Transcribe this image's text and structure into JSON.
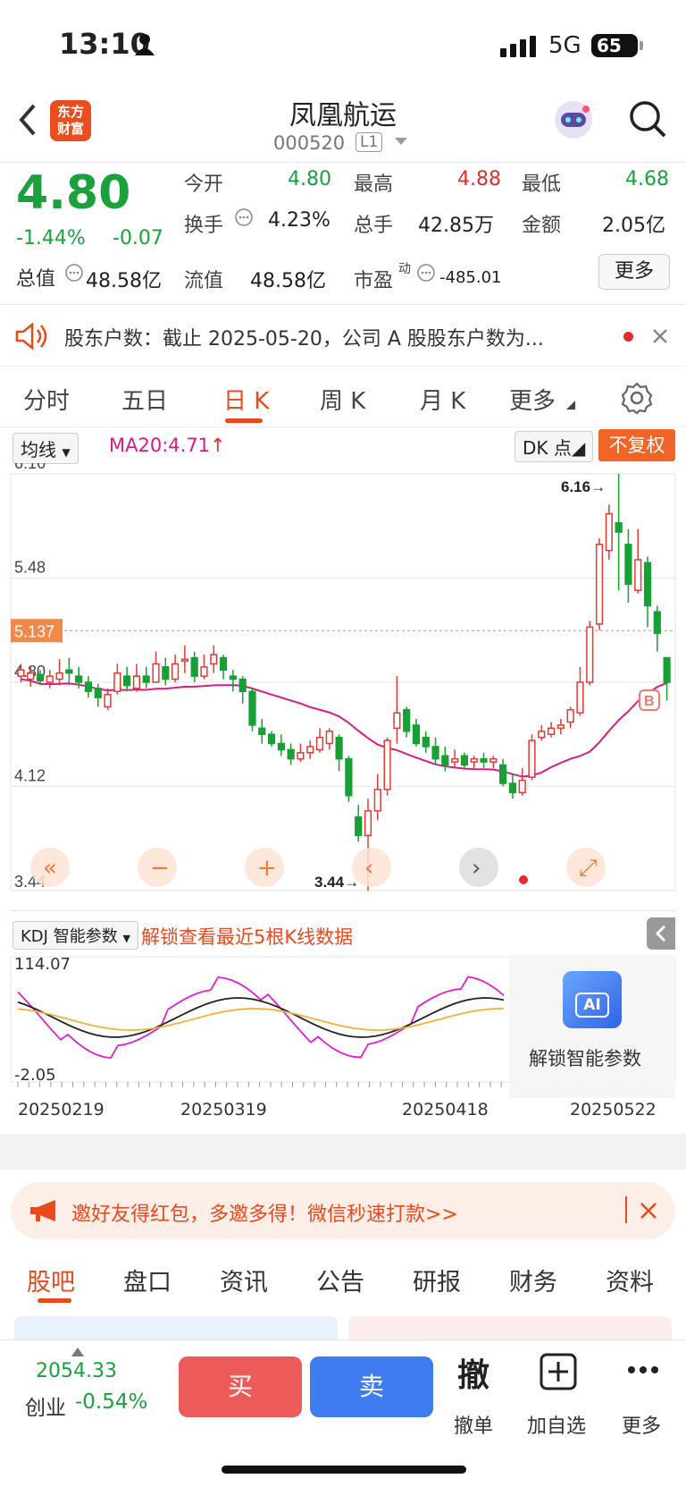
{
  "status": {
    "time": "13:10",
    "network": "5G",
    "battery": "65"
  },
  "header": {
    "title": "凤凰航运",
    "code": "000520",
    "level": "L1",
    "logo_line1": "东方",
    "logo_line2": "财富"
  },
  "quote": {
    "price": "4.80",
    "pct": "-1.44%",
    "chg": "-0.07",
    "open_label": "今开",
    "open": "4.80",
    "high_label": "最高",
    "high": "4.88",
    "low_label": "最低",
    "low": "4.68",
    "turnover_label": "换手",
    "turnover": "4.23%",
    "volume_label": "总手",
    "volume": "42.85万",
    "amount_label": "金额",
    "amount": "2.05亿",
    "mktcap_label": "总值",
    "mktcap": "48.58亿",
    "float_label": "流值",
    "float": "48.58亿",
    "pe_label": "市盈",
    "pe_sup": "动",
    "pe": "-485.01",
    "more": "更多"
  },
  "notice": {
    "text": "股东户数：截止 2025-05-20，公司 A 股股东户数为..."
  },
  "tabs": [
    "分时",
    "五日",
    "日 K",
    "周 K",
    "月 K",
    "更多"
  ],
  "active_tab": 2,
  "kline": {
    "ma_select": "均线",
    "ma_text": "MA20:4.71",
    "dk": "DK 点",
    "fq": "不复权",
    "y_labels": [
      "6.16",
      "5.48",
      "4.80",
      "4.12",
      "3.44"
    ],
    "ref_price": "5.137",
    "max_label": "6.16",
    "min_label": "3.44",
    "b_badge": "B"
  },
  "kdj": {
    "select": "KDJ 智能参数",
    "unlock_text": "解锁查看最近5根K线数据",
    "ymax": "114.07",
    "ymin": "-2.05",
    "ai_badge": "AI",
    "ai_text": "解锁智能参数",
    "dates": [
      "20250219",
      "20250319",
      "20250418",
      "20250522"
    ]
  },
  "banner": {
    "text": "邀好友得红包，多邀多得！微信秒速打款>>"
  },
  "bottom_tabs": [
    "股吧",
    "盘口",
    "资讯",
    "公告",
    "研报",
    "财务",
    "资料"
  ],
  "bottom": {
    "index_value": "2054.33",
    "index_name": "创业",
    "index_pct": "-0.54%",
    "buy": "买",
    "sell": "卖",
    "cancel_icon": "撤",
    "cancel": "撤单",
    "add": "加自选",
    "more": "更多"
  },
  "chart_data": {
    "type": "candlestick",
    "ylim": [
      3.44,
      6.16
    ],
    "candles": [
      [
        4.84,
        4.88,
        4.8,
        4.92
      ],
      [
        4.82,
        4.86,
        4.77,
        4.9
      ],
      [
        4.85,
        4.81,
        4.78,
        4.88
      ],
      [
        4.8,
        4.84,
        4.76,
        4.88
      ],
      [
        4.82,
        4.86,
        4.78,
        4.95
      ],
      [
        4.88,
        4.86,
        4.78,
        4.96
      ],
      [
        4.84,
        4.8,
        4.76,
        4.9
      ],
      [
        4.8,
        4.74,
        4.7,
        4.84
      ],
      [
        4.76,
        4.7,
        4.64,
        4.79
      ],
      [
        4.64,
        4.72,
        4.62,
        4.76
      ],
      [
        4.74,
        4.86,
        4.72,
        4.92
      ],
      [
        4.84,
        4.78,
        4.74,
        4.9
      ],
      [
        4.76,
        4.84,
        4.74,
        4.92
      ],
      [
        4.84,
        4.8,
        4.76,
        4.9
      ],
      [
        4.8,
        4.92,
        4.8,
        5.0
      ],
      [
        4.9,
        4.82,
        4.78,
        4.96
      ],
      [
        4.82,
        4.92,
        4.8,
        4.98
      ],
      [
        4.94,
        4.95,
        4.86,
        5.04
      ],
      [
        4.96,
        4.84,
        4.8,
        5.0
      ],
      [
        4.84,
        4.9,
        4.82,
        4.98
      ],
      [
        4.92,
        4.98,
        4.86,
        5.04
      ],
      [
        4.96,
        4.88,
        4.82,
        4.98
      ],
      [
        4.84,
        4.82,
        4.74,
        4.88
      ],
      [
        4.82,
        4.74,
        4.66,
        4.84
      ],
      [
        4.74,
        4.52,
        4.48,
        4.76
      ],
      [
        4.5,
        4.46,
        4.4,
        4.56
      ],
      [
        4.46,
        4.4,
        4.38,
        4.48
      ],
      [
        4.4,
        4.36,
        4.32,
        4.46
      ],
      [
        4.36,
        4.3,
        4.26,
        4.4
      ],
      [
        4.3,
        4.34,
        4.28,
        4.4
      ],
      [
        4.34,
        4.38,
        4.3,
        4.42
      ],
      [
        4.36,
        4.44,
        4.34,
        4.5
      ],
      [
        4.4,
        4.48,
        4.36,
        4.5
      ],
      [
        4.44,
        4.3,
        4.22,
        4.46
      ],
      [
        4.3,
        4.06,
        4.02,
        4.32
      ],
      [
        3.92,
        3.8,
        3.76,
        4.0
      ],
      [
        3.8,
        3.96,
        3.44,
        4.04
      ],
      [
        3.96,
        4.1,
        3.9,
        4.2
      ],
      [
        4.1,
        4.42,
        4.06,
        4.44
      ],
      [
        4.5,
        4.6,
        4.4,
        4.84
      ],
      [
        4.62,
        4.48,
        4.44,
        4.64
      ],
      [
        4.52,
        4.4,
        4.38,
        4.56
      ],
      [
        4.44,
        4.38,
        4.34,
        4.48
      ],
      [
        4.38,
        4.3,
        4.26,
        4.44
      ],
      [
        4.32,
        4.26,
        4.22,
        4.38
      ],
      [
        4.28,
        4.3,
        4.24,
        4.36
      ],
      [
        4.32,
        4.26,
        4.24,
        4.34
      ],
      [
        4.28,
        4.3,
        4.24,
        4.32
      ],
      [
        4.3,
        4.28,
        4.24,
        4.34
      ],
      [
        4.28,
        4.3,
        4.24,
        4.32
      ],
      [
        4.26,
        4.14,
        4.12,
        4.3
      ],
      [
        4.14,
        4.08,
        4.04,
        4.2
      ],
      [
        4.08,
        4.16,
        4.06,
        4.24
      ],
      [
        4.18,
        4.42,
        4.16,
        4.46
      ],
      [
        4.44,
        4.48,
        4.42,
        4.52
      ],
      [
        4.46,
        4.5,
        4.44,
        4.54
      ],
      [
        4.5,
        4.52,
        4.46,
        4.56
      ],
      [
        4.54,
        4.62,
        4.5,
        4.64
      ],
      [
        4.6,
        4.8,
        4.58,
        4.9
      ],
      [
        4.8,
        5.16,
        4.78,
        5.2
      ],
      [
        5.18,
        5.7,
        5.14,
        5.74
      ],
      [
        5.66,
        5.9,
        5.6,
        5.96
      ],
      [
        5.84,
        5.78,
        5.4,
        6.16
      ],
      [
        5.7,
        5.44,
        5.32,
        5.8
      ],
      [
        5.4,
        5.6,
        5.38,
        5.8
      ],
      [
        5.58,
        5.3,
        5.16,
        5.62
      ],
      [
        5.26,
        5.12,
        5.0,
        5.3
      ],
      [
        4.96,
        4.8,
        4.68,
        4.88
      ]
    ],
    "ma20_label": "MA20"
  }
}
